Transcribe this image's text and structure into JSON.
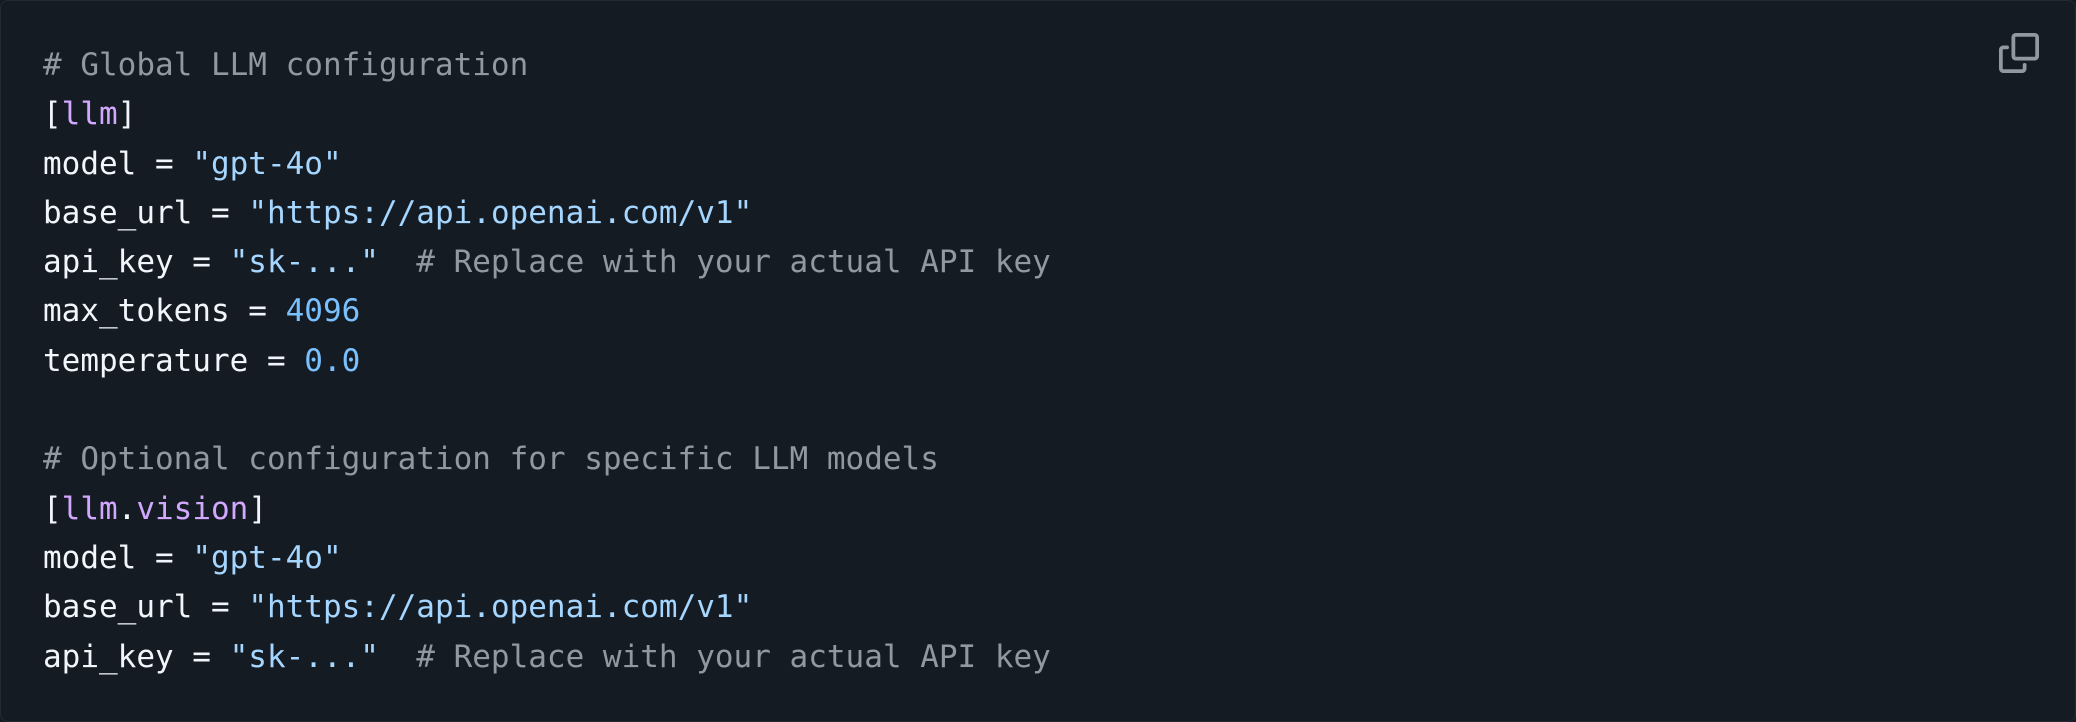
{
  "code": {
    "lines": [
      [
        {
          "t": "# Global LLM configuration",
          "c": "comment"
        }
      ],
      [
        {
          "t": "[",
          "c": "punct"
        },
        {
          "t": "llm",
          "c": "section"
        },
        {
          "t": "]",
          "c": "punct"
        }
      ],
      [
        {
          "t": "model = ",
          "c": "key"
        },
        {
          "t": "\"gpt-4o\"",
          "c": "string"
        }
      ],
      [
        {
          "t": "base_url = ",
          "c": "key"
        },
        {
          "t": "\"https://api.openai.com/v1\"",
          "c": "string"
        }
      ],
      [
        {
          "t": "api_key = ",
          "c": "key"
        },
        {
          "t": "\"sk-...\"",
          "c": "string"
        },
        {
          "t": "  # Replace with your actual API key",
          "c": "comment"
        }
      ],
      [
        {
          "t": "max_tokens = ",
          "c": "key"
        },
        {
          "t": "4096",
          "c": "number"
        }
      ],
      [
        {
          "t": "temperature = ",
          "c": "key"
        },
        {
          "t": "0.0",
          "c": "number"
        }
      ],
      [],
      [
        {
          "t": "# Optional configuration for specific LLM models",
          "c": "comment"
        }
      ],
      [
        {
          "t": "[",
          "c": "punct"
        },
        {
          "t": "llm",
          "c": "section"
        },
        {
          "t": ".",
          "c": "punct"
        },
        {
          "t": "vision",
          "c": "section"
        },
        {
          "t": "]",
          "c": "punct"
        }
      ],
      [
        {
          "t": "model = ",
          "c": "key"
        },
        {
          "t": "\"gpt-4o\"",
          "c": "string"
        }
      ],
      [
        {
          "t": "base_url = ",
          "c": "key"
        },
        {
          "t": "\"https://api.openai.com/v1\"",
          "c": "string"
        }
      ],
      [
        {
          "t": "api_key = ",
          "c": "key"
        },
        {
          "t": "\"sk-...\"",
          "c": "string"
        },
        {
          "t": "  # Replace with your actual API key",
          "c": "comment"
        }
      ]
    ]
  },
  "toolbar": {
    "copy_icon": "copy-icon"
  },
  "colors": {
    "background": "#151b23",
    "text": "#f0f6fc",
    "comment": "#9198a1",
    "section": "#d2a8ff",
    "string": "#a5d6ff",
    "number": "#79c0ff",
    "icon": "#9198a1"
  }
}
